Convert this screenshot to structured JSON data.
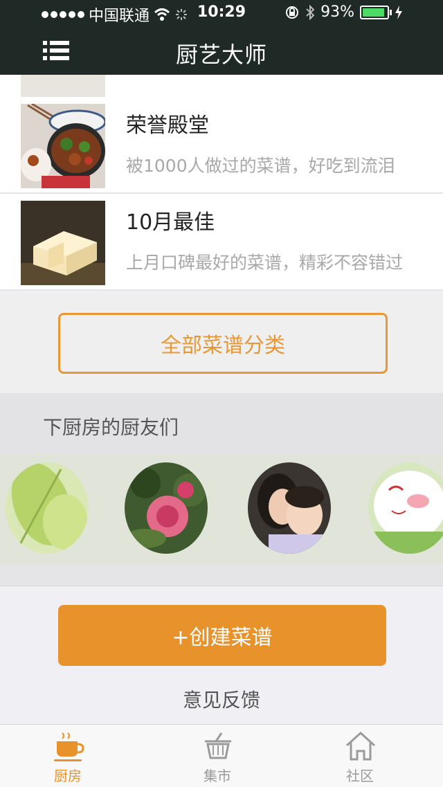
{
  "status": {
    "carrier": "中国联通",
    "time": "10:29",
    "battery": "93%",
    "battery_level": 0.93
  },
  "nav": {
    "title": "厨艺大师",
    "menu_icon": "menu-icon"
  },
  "recipes": [
    {
      "title": "荣誉殿堂",
      "subtitle": "被1000人做过的菜谱，好吃到流泪"
    },
    {
      "title": "10月最佳",
      "subtitle": "上月口碑最好的菜谱，精彩不容错过"
    }
  ],
  "all_categories_label": "全部菜谱分类",
  "friends": {
    "title": "下厨房的厨友们"
  },
  "create_label": "+创建菜谱",
  "feedback_label": "意见反馈",
  "tabs": [
    {
      "label": "厨房",
      "icon": "coffee-cup-icon",
      "active": true
    },
    {
      "label": "集市",
      "icon": "basket-icon",
      "active": false
    },
    {
      "label": "社区",
      "icon": "house-icon",
      "active": false
    }
  ],
  "colors": {
    "accent": "#e8922c",
    "nav_bg": "#1f2a27",
    "subtitle": "#a8a8a8"
  }
}
